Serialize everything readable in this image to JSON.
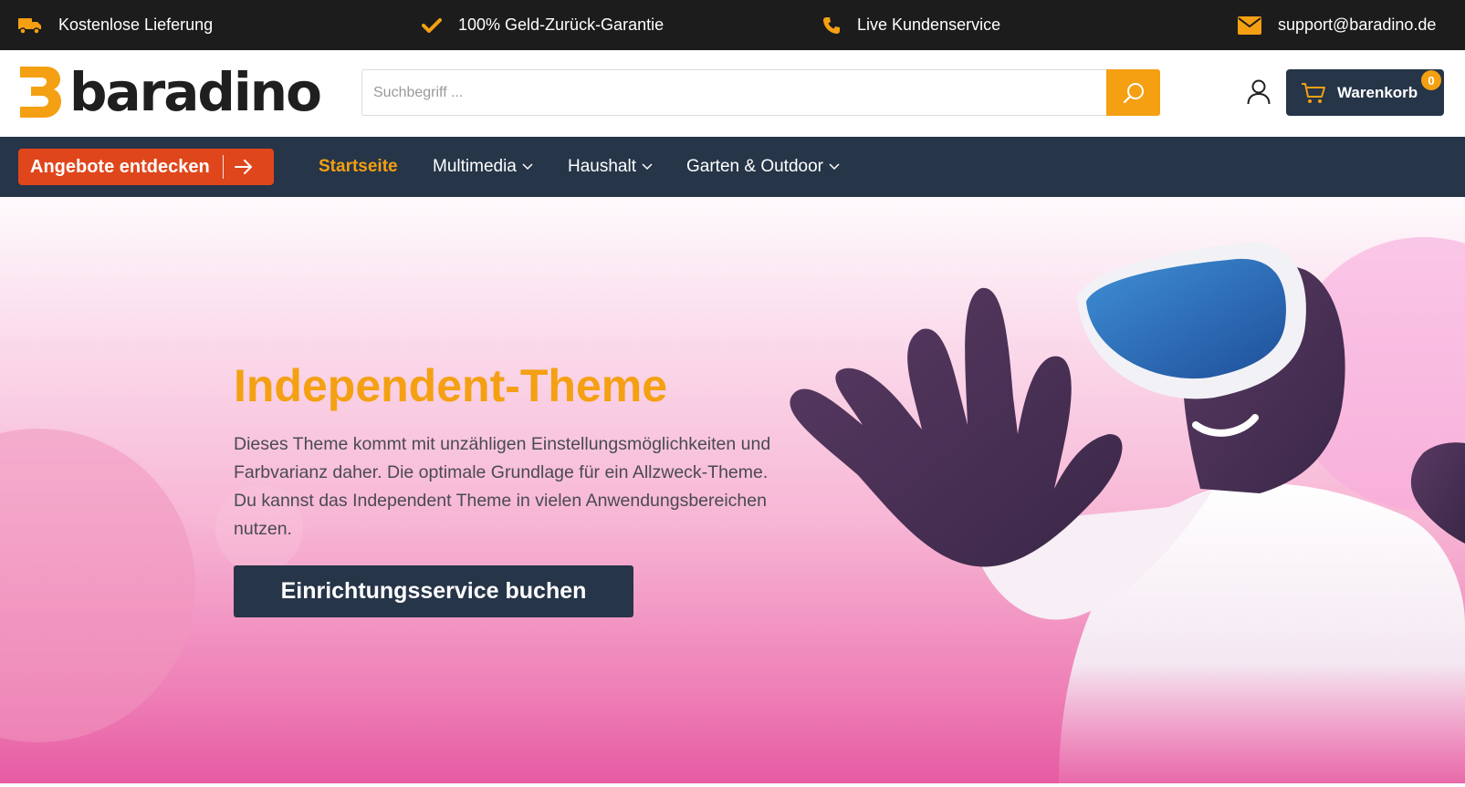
{
  "topbar": {
    "usps": [
      {
        "icon": "truck-icon",
        "label": "Kostenlose Lieferung"
      },
      {
        "icon": "check-icon",
        "label": "100% Geld-Zurück-Garantie"
      },
      {
        "icon": "phone-icon",
        "label": "Live Kundenservice"
      },
      {
        "icon": "envelope-icon",
        "label": "support@baradino.de"
      }
    ]
  },
  "header": {
    "logo_text": "baradino",
    "search": {
      "placeholder": "Suchbegriff ..."
    },
    "cart": {
      "label": "Warenkorb",
      "count": "0"
    }
  },
  "nav": {
    "deals_label": "Angebote entdecken",
    "items": [
      {
        "label": "Startseite",
        "active": true
      },
      {
        "label": "Multimedia",
        "dropdown": true
      },
      {
        "label": "Haushalt",
        "dropdown": true
      },
      {
        "label": "Garten & Outdoor",
        "dropdown": true
      }
    ]
  },
  "hero": {
    "title": "Independent-Theme",
    "text": "Dieses Theme kommt mit unzähligen Einstellungsmöglichkeiten und Farbvarianz daher. Die optimale Grundlage für ein Allzweck-Theme. Du kannst das Independent Theme in vielen Anwendungsbereichen nutzen.",
    "cta_label": "Einrichtungsservice buchen"
  },
  "colors": {
    "accent": "#f4a012",
    "navy": "#263548",
    "deals": "#e0461c",
    "topbar": "#1c1c1c"
  }
}
